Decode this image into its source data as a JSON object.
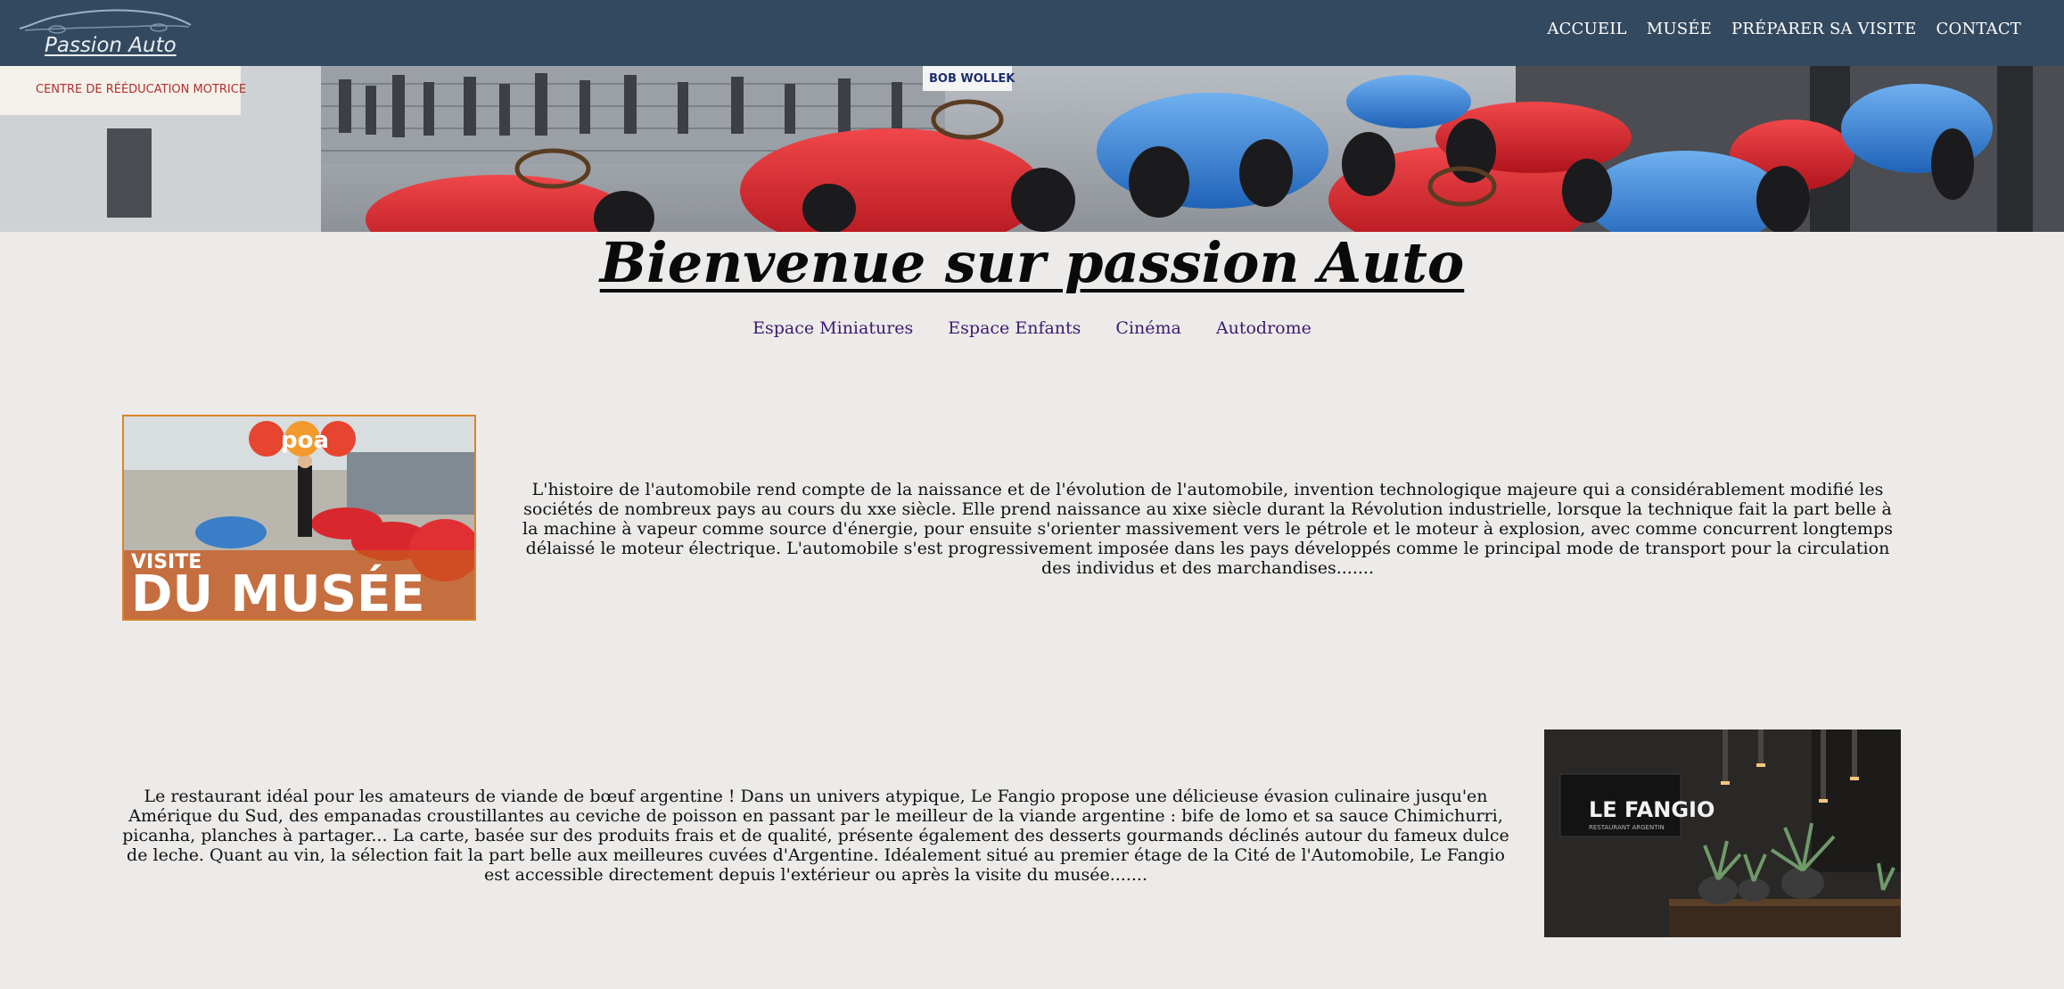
{
  "header": {
    "logo_text": "Passion Auto",
    "nav": [
      "ACCUEIL",
      "MUSÉE",
      "PRÉPARER SA VISITE",
      "CONTACT"
    ]
  },
  "hero": {
    "sign_top_left": "CENTRE DE RÉÉDUCATION MOTRICE",
    "sign_banner": "BOB WOLLEK"
  },
  "page": {
    "title": "Bienvenue sur passion Auto",
    "subnav": [
      "Espace Miniatures",
      "Espace Enfants",
      "Cinéma",
      "Autodrome"
    ]
  },
  "section1": {
    "image_badge": "poa",
    "image_caption_small": "VISITE",
    "image_caption_big": "DU MUSÉE",
    "text": "L'histoire de l'automobile rend compte de la naissance et de l'évolution de l'automobile, invention technologique majeure qui a considérablement modifié les sociétés de nombreux pays au cours du xxe siècle. Elle prend naissance au xixe siècle durant la Révolution industrielle, lorsque la technique fait la part belle à la machine à vapeur comme source d'énergie, pour ensuite s'orienter massivement vers le pétrole et le moteur à explosion, avec comme concurrent longtemps délaissé le moteur électrique. L'automobile s'est progressivement imposée dans les pays développés comme le principal mode de transport pour la circulation des individus et des marchandises......."
  },
  "section2": {
    "text": "Le restaurant idéal pour les amateurs de viande de bœuf argentine ! Dans un univers atypique, Le Fangio propose une délicieuse évasion culinaire jusqu'en Amérique du Sud, des empanadas croustillantes au ceviche de poisson en passant par le meilleur de la viande argentine : bife de lomo et sa sauce Chimichurri, picanha, planches à partager... La carte, basée sur des produits frais et de qualité, présente également des desserts gourmands déclinés autour du fameux dulce de leche. Quant au vin, la sélection fait la part belle aux meilleures cuvées d'Argentine. Idéalement situé au premier étage de la Cité de l'Automobile, Le Fangio est accessible directement depuis l'extérieur ou après la visite du musée.......",
    "image_sign": "LE FANGIO",
    "image_sign_small": "RESTAURANT ARGENTIN"
  },
  "colors": {
    "header_bg": "#33495f",
    "page_bg": "#edebe9",
    "subnav_link": "#3b1a70",
    "image_border": "#d9842a"
  }
}
